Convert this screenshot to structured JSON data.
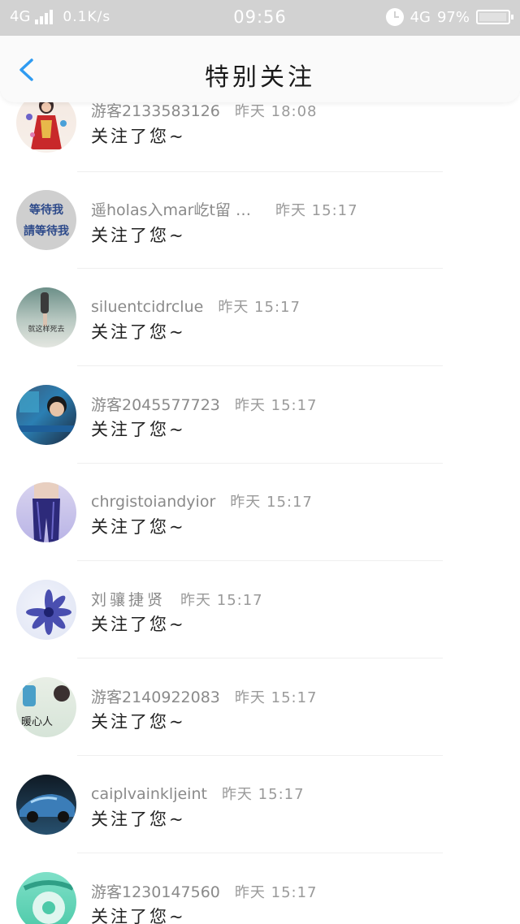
{
  "status_bar": {
    "network": "4G",
    "speed": "0.1K/s",
    "time": "09:56",
    "network_right": "4G",
    "battery": "97%",
    "battery_level": 0.97
  },
  "nav": {
    "title": "特别关注",
    "back_icon": "chevron-left-icon",
    "accent": "#2f9bf1"
  },
  "items": [
    {
      "name": "游客2133583126",
      "time": "昨天 18:08",
      "message": "关注了您~",
      "avatar": "costume-figure"
    },
    {
      "name": "遥holas入mar屹t留 …",
      "time": "昨天 15:17",
      "message": "关注了您~",
      "avatar": "text-waiting",
      "avatar_text": [
        "等待我",
        "請等待我"
      ]
    },
    {
      "name": "siluentcidrclue",
      "time": "昨天 15:17",
      "message": "关注了您~",
      "avatar": "beach-text",
      "avatar_text": [
        "就这样死去"
      ]
    },
    {
      "name": "游客2045577723",
      "time": "昨天 15:17",
      "message": "关注了您~",
      "avatar": "portrait"
    },
    {
      "name": "chrgistoiandyior",
      "time": "昨天 15:17",
      "message": "关注了您~",
      "avatar": "blue-legs"
    },
    {
      "name": "刘骧捷贤",
      "time": "昨天 15:17",
      "message": "关注了您~",
      "avatar": "flower"
    },
    {
      "name": "游客2140922083",
      "time": "昨天 15:17",
      "message": "关注了您~",
      "avatar": "warm-heart",
      "avatar_text": [
        "暖心人"
      ]
    },
    {
      "name": "caiplvainkljeint",
      "time": "昨天 15:17",
      "message": "关注了您~",
      "avatar": "car"
    },
    {
      "name": "游客1230147560",
      "time": "昨天 15:17",
      "message": "关注了您~",
      "avatar": "teal-phone"
    }
  ]
}
